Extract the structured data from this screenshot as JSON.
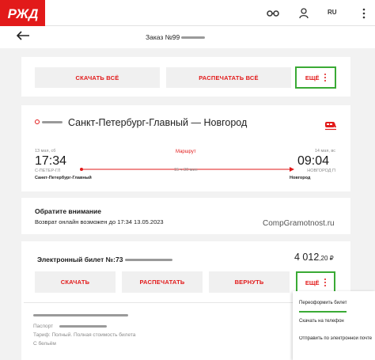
{
  "header": {
    "logo_text": "РЖД",
    "lang": "RU",
    "icons": [
      "glasses-icon",
      "user-icon",
      "more-vertical-icon"
    ]
  },
  "subheader": {
    "order_label": "Заказ №99"
  },
  "actions": {
    "download_all": "СКАЧАТЬ ВСЁ",
    "print_all": "РАСПЕЧАТАТЬ ВСЁ",
    "more": "ЕЩЁ"
  },
  "trip": {
    "route": "Санкт-Петербург-Главный — Новгород",
    "departure": {
      "date": "13 мая, сб",
      "time": "17:34",
      "city": "С-ПЕТЕР-ГЛ",
      "station": "Санкт-Петербург-Главный"
    },
    "arrival": {
      "date": "14 мая, вс",
      "time": "09:04",
      "city": "НОВГОРОД П",
      "station": "Новгород"
    },
    "route_label": "Маршрут",
    "duration": "15 ч 30 мин"
  },
  "notice": {
    "title": "Обратите внимание",
    "text": "Возврат онлайн возможен до 17:34 13.05.2023",
    "watermark": "CompGramotnost.ru"
  },
  "ticket": {
    "title": "Электронный билет №:73",
    "price_main": "4 012",
    "price_cents": ",20 ₽",
    "download": "СКАЧАТЬ",
    "print": "РАСПЕЧАТАТЬ",
    "refund": "ВЕРНУТЬ",
    "more": "ЕЩЁ"
  },
  "passenger": {
    "passport_label": "Паспорт",
    "tariff": "Тариф: Полный. Полная стоимость билета",
    "linen": "С бельём"
  },
  "dropdown": {
    "items": [
      "Переоформить билет",
      "Скачать на телефон",
      "Отправить по электронной почте"
    ]
  },
  "colors": {
    "brand_red": "#e21a1a",
    "highlight_green": "#3aaa35"
  }
}
